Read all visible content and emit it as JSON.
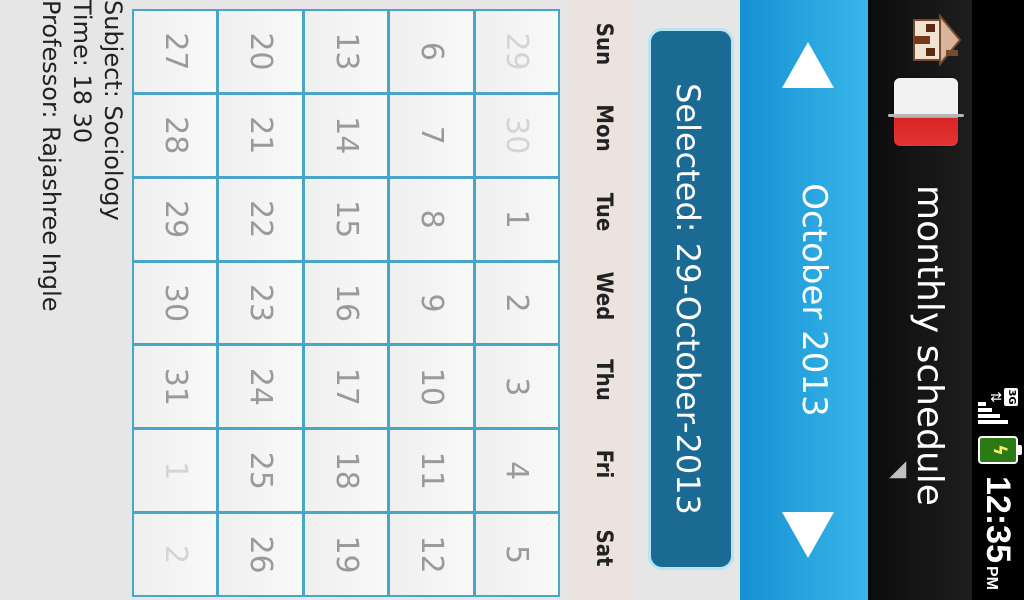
{
  "status": {
    "network": "3G",
    "clock": "12:35",
    "ampm": "PM"
  },
  "actionbar": {
    "title": "monthly schedule"
  },
  "calendar": {
    "month_title": "October 2013",
    "selected_text": "Selected: 29-October-2013",
    "weekdays": [
      "Sun",
      "Mon",
      "Tue",
      "Wed",
      "Thu",
      "Fri",
      "Sat"
    ],
    "weeks": [
      [
        {
          "day": "29",
          "muted": true
        },
        {
          "day": "30",
          "muted": true
        },
        {
          "day": "1"
        },
        {
          "day": "2"
        },
        {
          "day": "3"
        },
        {
          "day": "4"
        },
        {
          "day": "5"
        }
      ],
      [
        {
          "day": "6"
        },
        {
          "day": "7"
        },
        {
          "day": "8"
        },
        {
          "day": "9"
        },
        {
          "day": "10"
        },
        {
          "day": "11"
        },
        {
          "day": "12"
        }
      ],
      [
        {
          "day": "13"
        },
        {
          "day": "14"
        },
        {
          "day": "15"
        },
        {
          "day": "16"
        },
        {
          "day": "17"
        },
        {
          "day": "18"
        },
        {
          "day": "19"
        }
      ],
      [
        {
          "day": "20"
        },
        {
          "day": "21"
        },
        {
          "day": "22"
        },
        {
          "day": "23"
        },
        {
          "day": "24"
        },
        {
          "day": "25"
        },
        {
          "day": "26"
        }
      ],
      [
        {
          "day": "27"
        },
        {
          "day": "28"
        },
        {
          "day": "29"
        },
        {
          "day": "30"
        },
        {
          "day": "31"
        },
        {
          "day": "1",
          "muted": true
        },
        {
          "day": "2",
          "muted": true
        }
      ]
    ]
  },
  "details": {
    "subject": "Subject: Sociology",
    "time": "Time: 18 30",
    "professor": "Professor: Rajashree Ingle"
  }
}
